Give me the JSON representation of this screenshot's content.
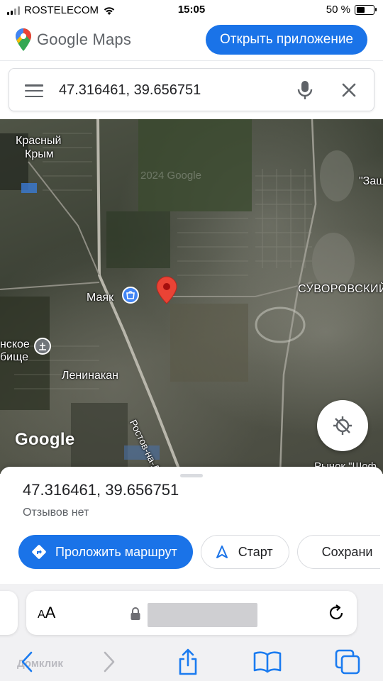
{
  "status_bar": {
    "carrier": "ROSTELECOM",
    "time": "15:05",
    "battery_text": "50 %",
    "battery_level": 0.5
  },
  "header": {
    "logo_text": "Google Maps",
    "open_app_label": "Открыть приложение"
  },
  "search": {
    "value": "47.316461, 39.656751"
  },
  "map": {
    "labels": {
      "krasny": "Красный",
      "krym": "Крым",
      "mayak": "Маяк",
      "suvorovsky": "СУВОРОВСКИЙ",
      "leninakan": "Ленинакан",
      "kladbishche_1": "нское",
      "kladbishche_2": "бище",
      "rostov_road": "Ростов-на-До",
      "zash": "\"Защ",
      "rynok": "Рынок \"Шоф",
      "watermark_year": "2024 Google"
    },
    "attribution": "Google"
  },
  "place": {
    "title": "47.316461, 39.656751",
    "reviews": "Отзывов нет",
    "directions_label": "Проложить маршрут",
    "start_label": "Старт",
    "save_label": "Сохрани"
  },
  "browser": {
    "aa_label_small": "A",
    "aa_label_big": "A",
    "watermark": "Домклик"
  },
  "colors": {
    "accent": "#1a73e8",
    "pin": "#ea4335"
  }
}
